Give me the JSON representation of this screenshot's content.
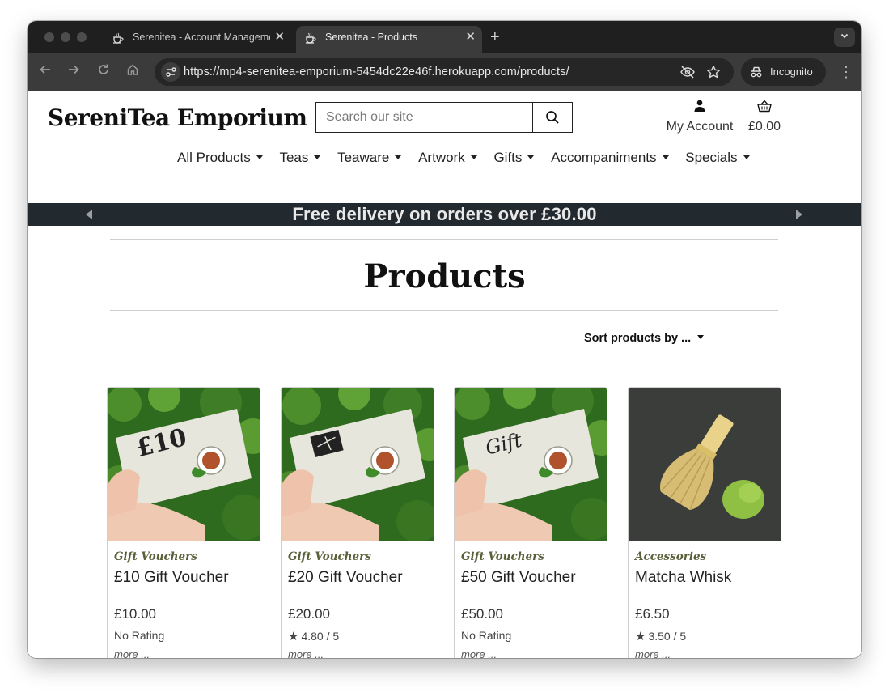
{
  "browser": {
    "tabs": [
      {
        "title": "Serenitea - Account Management",
        "active": false
      },
      {
        "title": "Serenitea - Products",
        "active": true
      }
    ],
    "url": "https://mp4-serenitea-emporium-5454dc22e46f.herokuapp.com/products/",
    "incognito_label": "Incognito",
    "icons": [
      "back-arrow-icon",
      "forward-arrow-icon",
      "reload-icon",
      "home-icon",
      "site-settings-icon",
      "eye-slash-icon",
      "star-icon",
      "incognito-icon",
      "kebab-menu-icon"
    ]
  },
  "site": {
    "brand": "SereniTea Emporium",
    "search_placeholder": "Search our site",
    "account_label": "My Account",
    "basket_total": "£0.00",
    "nav": [
      "All Products",
      "Teas",
      "Teaware",
      "Artwork",
      "Gifts",
      "Accompaniments",
      "Specials"
    ],
    "banner": "Free delivery on orders over £30.00"
  },
  "main": {
    "title": "Products",
    "sort_label": "Sort products by ...",
    "products": [
      {
        "category": "Gift Vouchers",
        "name": "£10 Gift Voucher",
        "price": "£10.00",
        "rating": "No Rating",
        "more": "more ...",
        "card_text": "£10"
      },
      {
        "category": "Gift Vouchers",
        "name": "£20 Gift Voucher",
        "price": "£20.00",
        "rating": "4.80 / 5",
        "more": "more ..."
      },
      {
        "category": "Gift Vouchers",
        "name": "£50 Gift Voucher",
        "price": "£50.00",
        "rating": "No Rating",
        "more": "more ...",
        "card_text": "Gift"
      },
      {
        "category": "Accessories",
        "name": "Matcha Whisk",
        "price": "£6.50",
        "rating": "3.50 / 5",
        "more": "more ..."
      }
    ]
  },
  "colors": {
    "banner_bg": "#222a30",
    "category": "#5a5f3a",
    "chrome_tabbar": "#1f1f1f",
    "chrome_toolbar": "#3b3b3b"
  }
}
